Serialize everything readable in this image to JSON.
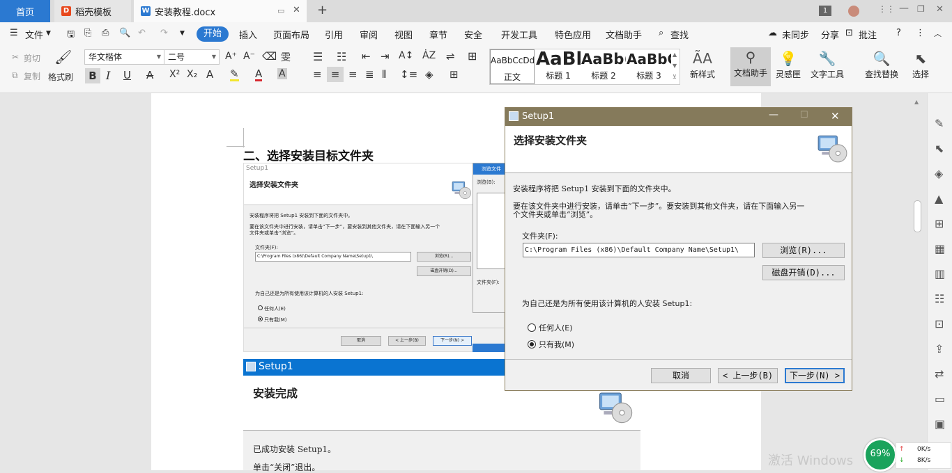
{
  "tabs": {
    "home": "首页",
    "doc1": "稻壳模板",
    "active": "安装教程.docx",
    "new": "+"
  },
  "titlebar": {
    "badge": "1"
  },
  "menu": {
    "file": "文件",
    "start": "开始",
    "items": [
      "插入",
      "页面布局",
      "引用",
      "审阅",
      "视图",
      "章节",
      "安全",
      "开发工具",
      "特色应用",
      "文档助手"
    ],
    "search": "查找",
    "sync": "未同步",
    "share": "分享",
    "comment": "批注",
    "help": "?"
  },
  "ribbon": {
    "cut": "剪切",
    "copy": "复制",
    "format_painter": "格式刷",
    "font_name": "华文楷体",
    "font_size": "二号",
    "styles": [
      {
        "preview": "AaBbCcDd",
        "name": "正文"
      },
      {
        "preview": "AaBl",
        "name": "标题 1"
      },
      {
        "preview": "AaBb(",
        "name": "标题 2"
      },
      {
        "preview": "AaBbC",
        "name": "标题 3"
      }
    ],
    "new_style": "新样式",
    "doc_assistant": "文档助手",
    "inspiration": "灵感匣",
    "text_tools": "文字工具",
    "find_replace": "查找替换",
    "select": "选择"
  },
  "doc": {
    "heading": "二、选择安装目标文件夹",
    "emb1": {
      "title": "Setup1",
      "header": "选择安装文件夹",
      "line1": "安装程序将把 Setup1 安装到下面的文件夹中。",
      "line2": "要在该文件夹中进行安装，请单击“下一步”，要安装到其他文件夹，请在下面输入另一个",
      "line3": "文件夹或单击“浏览”。",
      "folder_label": "文件夹(F):",
      "path": "C:\\Program Files (x86)\\Default Company Name\\Setup1\\",
      "browse": "浏览(R)...",
      "disk": "磁盘开销(D)...",
      "question": "为自己还是为所有使用该计算机的人安装 Setup1:",
      "anyone": "任何人(E)",
      "justme": "只有我(M)",
      "cancel": "取消",
      "back": "< 上一步(B)",
      "next": "下一步(N) >",
      "browse_win_title": "浏览文件",
      "browse_label": "浏览(B):",
      "browse_folder": "文件夹(F):"
    },
    "emb2": {
      "title": "Setup1",
      "header": "安装完成",
      "line1": "已成功安装 Setup1。",
      "line2": "单击“关闭”退出。"
    }
  },
  "dialog": {
    "title": "Setup1",
    "header": "选择安装文件夹",
    "line1": "安装程序将把 Setup1 安装到下面的文件夹中。",
    "line2": "要在该文件夹中进行安装，请单击“下一步”。要安装到其他文件夹，请在下面输入另一",
    "line3": "个文件夹或单击“浏览”。",
    "folder_label": "文件夹(F):",
    "path": "C:\\Program Files (x86)\\Default Company Name\\Setup1\\",
    "browse": "浏览(R)...",
    "disk": "磁盘开销(D)...",
    "question": "为自己还是为所有使用该计算机的人安装 Setup1:",
    "anyone": "任何人(E)",
    "justme": "只有我(M)",
    "cancel": "取消",
    "back": "< 上一步(B)",
    "next": "下一步(N) >"
  },
  "status": {
    "percent": "69%",
    "up": "0K/s",
    "down": "8K/s",
    "watermark": "激活 Windows"
  }
}
